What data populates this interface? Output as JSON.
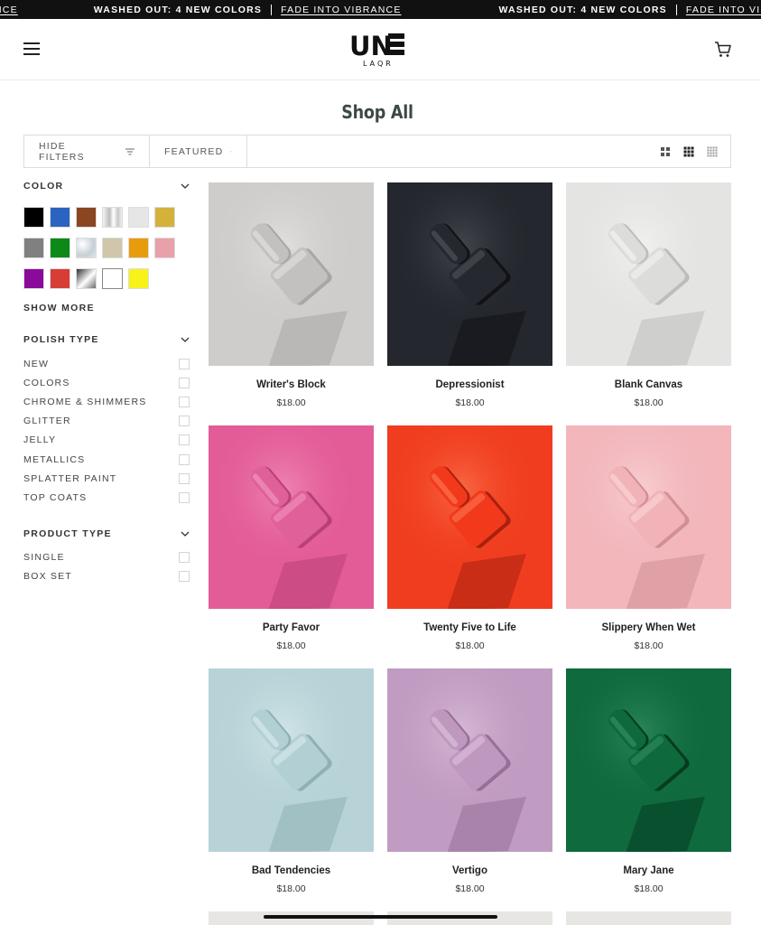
{
  "announcement": {
    "leading_fragment": "NCE",
    "messages": [
      {
        "strong": "WASHED OUT: 4 NEW COLORS",
        "link": "FADE INTO VIBRANCE"
      },
      {
        "strong": "WASHED OUT: 4 NEW COLORS",
        "link": "FADE INTO VIBRANCE"
      }
    ]
  },
  "header": {
    "menu_icon": "hamburger-menu-icon",
    "logo_top": "UN",
    "logo_side": "DN",
    "logo_bottom": "LAQR",
    "cart_icon": "shopping-cart-icon"
  },
  "page": {
    "title": "Shop All"
  },
  "toolbar": {
    "filters_label": "HIDE FILTERS",
    "filters_icon": "filter-lines-icon",
    "sort_label": "FEATURED",
    "sort_icon": "sort-lines-icon",
    "view_icons": [
      "grid-large-icon",
      "grid-medium-icon",
      "grid-small-icon"
    ]
  },
  "filters": {
    "color": {
      "title": "COLOR",
      "swatches": [
        {
          "name": "black",
          "color": "#000000"
        },
        {
          "name": "blue",
          "color": "#2a64c0"
        },
        {
          "name": "brown",
          "color": "#8b4520"
        },
        {
          "name": "chrome",
          "color": "linear-gradient(90deg,#f4f4f4,#bdbdbd 35%,#ffffff 55%,#c7c7c7 80%,#f0f0f0)"
        },
        {
          "name": "light-gray",
          "color": "#e6e6e6"
        },
        {
          "name": "gold",
          "color": "#d4b13a"
        },
        {
          "name": "gray",
          "color": "#808080"
        },
        {
          "name": "green",
          "color": "#0b8a18"
        },
        {
          "name": "glitter",
          "color": "radial-gradient(circle at 30% 30%,#ffffff,#c6d0d6 60%,#e2e6e9)"
        },
        {
          "name": "beige",
          "color": "#cfc6ab"
        },
        {
          "name": "orange",
          "color": "#e89c0c"
        },
        {
          "name": "pink",
          "color": "#e8a0aa"
        },
        {
          "name": "purple",
          "color": "#8a0a9a"
        },
        {
          "name": "red",
          "color": "#d83d35"
        },
        {
          "name": "metallic-gray",
          "color": "linear-gradient(135deg,#2e2e2e,#ffffff 55%,#6c6c6c)"
        },
        {
          "name": "white",
          "color": "#ffffff"
        },
        {
          "name": "yellow",
          "color": "#f7f21a"
        }
      ],
      "show_more": "SHOW MORE",
      "chevron_icon": "chevron-down-icon"
    },
    "polish_type": {
      "title": "POLISH TYPE",
      "options": [
        "NEW",
        "COLORS",
        "CHROME & SHIMMERS",
        "GLITTER",
        "JELLY",
        "METALLICS",
        "SPLATTER PAINT",
        "TOP COATS"
      ],
      "chevron_icon": "chevron-down-icon"
    },
    "product_type": {
      "title": "PRODUCT TYPE",
      "options": [
        "SINGLE",
        "BOX SET"
      ],
      "chevron_icon": "chevron-down-icon"
    }
  },
  "products": [
    {
      "name": "Writer's Block",
      "price": "$18.00",
      "bg": "#cfcdcb",
      "bottle": "#c3c1bf",
      "shade": "#a9a7a5",
      "hi": "#efeeed"
    },
    {
      "name": "Depressionist",
      "price": "$18.00",
      "bg": "#24272d",
      "bottle": "#25282e",
      "shade": "#101216",
      "hi": "#5c6068"
    },
    {
      "name": "Blank Canvas",
      "price": "$18.00",
      "bg": "#e4e4e3",
      "bottle": "#dcdcdb",
      "shade": "#bdbdbc",
      "hi": "#fbfbfb"
    },
    {
      "name": "Party Favor",
      "price": "$18.00",
      "bg": "#e35c97",
      "bottle": "#e0609a",
      "shade": "#b93f77",
      "hi": "#f7a6c8"
    },
    {
      "name": "Twenty Five to Life",
      "price": "$18.00",
      "bg": "#f03d1f",
      "bottle": "#f2391c",
      "shade": "#a9200d",
      "hi": "#ff8a62"
    },
    {
      "name": "Slippery When Wet",
      "price": "$18.00",
      "bg": "#f2b6bb",
      "bottle": "#f1b3b8",
      "shade": "#d28f96",
      "hi": "#fde1e3"
    },
    {
      "name": "Bad Tendencies",
      "price": "$18.00",
      "bg": "#b7d3d7",
      "bottle": "#b2d0d4",
      "shade": "#8fb0b5",
      "hi": "#e5f2f3"
    },
    {
      "name": "Vertigo",
      "price": "$18.00",
      "bg": "#c19cc2",
      "bottle": "#be98bf",
      "shade": "#976f98",
      "hi": "#e6d0e6"
    },
    {
      "name": "Mary Jane",
      "price": "$18.00",
      "bg": "#0f6a3e",
      "bottle": "#0e6a3d",
      "shade": "#063b21",
      "hi": "#3f9a6c"
    }
  ],
  "peek_colors": [
    "#e8e6e3",
    "#e8e6e3",
    "#e8e6e3"
  ]
}
